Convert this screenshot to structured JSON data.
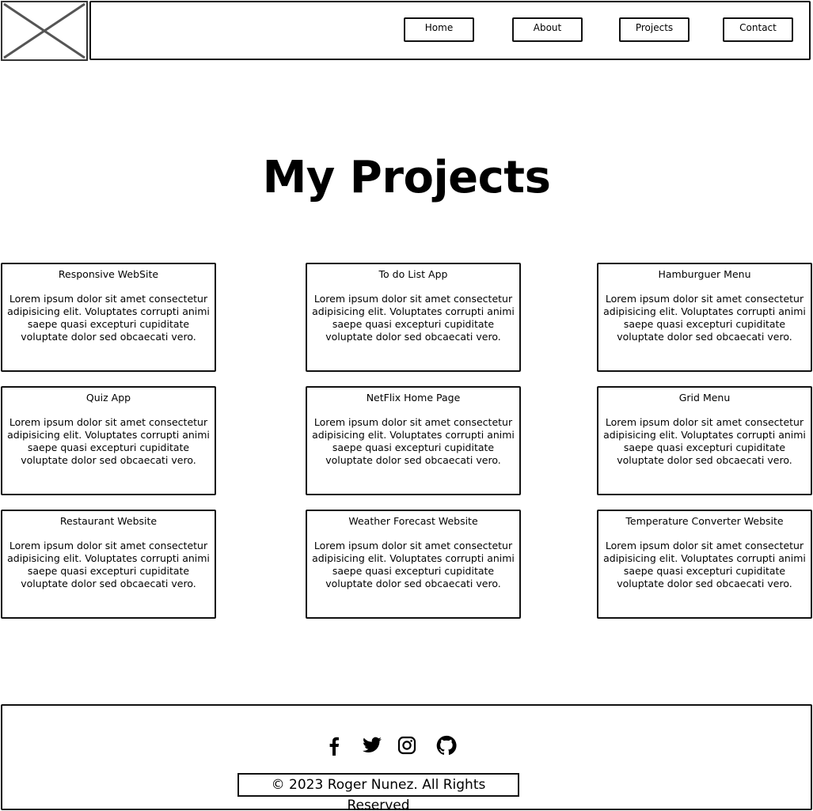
{
  "nav": {
    "logo_icon": "image-placeholder-icon",
    "items": [
      {
        "label": "Home"
      },
      {
        "label": "About"
      },
      {
        "label": "Projects"
      },
      {
        "label": "Contact"
      }
    ]
  },
  "main": {
    "title": "My Projects",
    "projects": [
      {
        "title": "Responsive WebSite",
        "description": "Lorem ipsum dolor sit amet consectetur adipisicing elit. Voluptates corrupti animi saepe quasi excepturi cupiditate voluptate dolor sed obcaecati vero."
      },
      {
        "title": "To do List App",
        "description": "Lorem ipsum dolor sit amet consectetur adipisicing elit. Voluptates corrupti animi saepe quasi excepturi cupiditate voluptate dolor sed obcaecati vero."
      },
      {
        "title": "Hamburguer Menu",
        "description": "Lorem ipsum dolor sit amet consectetur adipisicing elit. Voluptates corrupti animi saepe quasi excepturi cupiditate voluptate dolor sed obcaecati vero."
      },
      {
        "title": "Quiz App",
        "description": "Lorem ipsum dolor sit amet consectetur adipisicing elit. Voluptates corrupti animi saepe quasi excepturi cupiditate voluptate dolor sed obcaecati vero."
      },
      {
        "title": "NetFlix Home Page",
        "description": "Lorem ipsum dolor sit amet consectetur adipisicing elit. Voluptates corrupti animi saepe quasi excepturi cupiditate voluptate dolor sed obcaecati vero."
      },
      {
        "title": "Grid Menu",
        "description": "Lorem ipsum dolor sit amet consectetur adipisicing elit. Voluptates corrupti animi saepe quasi excepturi cupiditate voluptate dolor sed obcaecati vero."
      },
      {
        "title": "Restaurant Website",
        "description": "Lorem ipsum dolor sit amet consectetur adipisicing elit. Voluptates corrupti animi saepe quasi excepturi cupiditate voluptate dolor sed obcaecati vero."
      },
      {
        "title": "Weather Forecast Website",
        "description": "Lorem ipsum dolor sit amet consectetur adipisicing elit. Voluptates corrupti animi saepe quasi excepturi cupiditate voluptate dolor sed obcaecati vero."
      },
      {
        "title": "Temperature Converter Website",
        "description": "Lorem ipsum dolor sit amet consectetur adipisicing elit. Voluptates corrupti animi saepe quasi excepturi cupiditate voluptate dolor sed obcaecati vero."
      }
    ]
  },
  "footer": {
    "social_icons": [
      "facebook-icon",
      "twitter-icon",
      "instagram-icon",
      "github-icon"
    ],
    "copyright": "© 2023 Roger Nunez. All Rights Reserved"
  }
}
